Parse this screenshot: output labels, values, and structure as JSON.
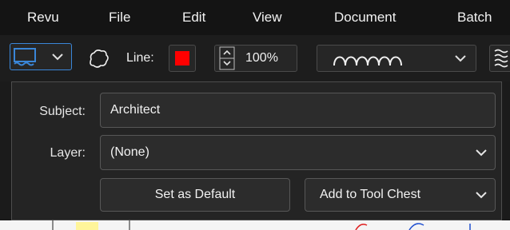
{
  "menu": {
    "items": [
      "Revu",
      "File",
      "Edit",
      "View",
      "Document",
      "Batch"
    ]
  },
  "toolbar": {
    "line_label": "Line:",
    "line_color": "#ff0000",
    "opacity_value": "100%",
    "icons": [
      "markup-style-dropdown-icon",
      "cloud-shape-icon",
      "color-swatch",
      "opacity-stepper-icon",
      "line-style-dropdown-icon",
      "hatch-icon"
    ]
  },
  "panel": {
    "subject_label": "Subject:",
    "subject_value": "Architect",
    "layer_label": "Layer:",
    "layer_value": "(None)",
    "set_default_label": "Set as Default",
    "add_tool_chest_label": "Add to Tool Chest"
  },
  "colors": {
    "accent_blue": "#3a86d8",
    "line_red": "#ff0000"
  }
}
